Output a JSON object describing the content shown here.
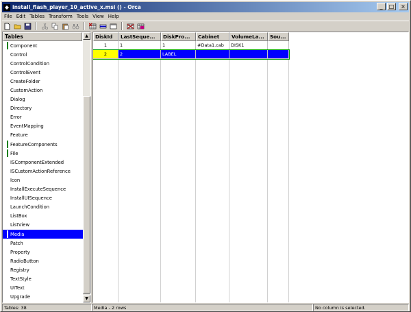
{
  "window": {
    "title": "install_flash_player_10_active_x.msi () - Orca"
  },
  "menu": [
    "File",
    "Edit",
    "Tables",
    "Transform",
    "Tools",
    "View",
    "Help"
  ],
  "left": {
    "header": "Tables",
    "items": [
      {
        "label": "Component",
        "marked": true,
        "selected": false
      },
      {
        "label": "Control",
        "marked": false,
        "selected": false
      },
      {
        "label": "ControlCondition",
        "marked": false,
        "selected": false
      },
      {
        "label": "ControlEvent",
        "marked": false,
        "selected": false
      },
      {
        "label": "CreateFolder",
        "marked": false,
        "selected": false
      },
      {
        "label": "CustomAction",
        "marked": false,
        "selected": false
      },
      {
        "label": "Dialog",
        "marked": false,
        "selected": false
      },
      {
        "label": "Directory",
        "marked": false,
        "selected": false
      },
      {
        "label": "Error",
        "marked": false,
        "selected": false
      },
      {
        "label": "EventMapping",
        "marked": false,
        "selected": false
      },
      {
        "label": "Feature",
        "marked": false,
        "selected": false
      },
      {
        "label": "FeatureComponents",
        "marked": true,
        "selected": false
      },
      {
        "label": "File",
        "marked": true,
        "selected": false
      },
      {
        "label": "ISComponentExtended",
        "marked": false,
        "selected": false
      },
      {
        "label": "ISCustomActionReference",
        "marked": false,
        "selected": false
      },
      {
        "label": "Icon",
        "marked": false,
        "selected": false
      },
      {
        "label": "InstallExecuteSequence",
        "marked": false,
        "selected": false
      },
      {
        "label": "InstallUISequence",
        "marked": false,
        "selected": false
      },
      {
        "label": "LaunchCondition",
        "marked": false,
        "selected": false
      },
      {
        "label": "ListBox",
        "marked": false,
        "selected": false
      },
      {
        "label": "ListView",
        "marked": false,
        "selected": false
      },
      {
        "label": "Media",
        "marked": true,
        "selected": true
      },
      {
        "label": "Patch",
        "marked": false,
        "selected": false
      },
      {
        "label": "Property",
        "marked": false,
        "selected": false
      },
      {
        "label": "RadioButton",
        "marked": false,
        "selected": false
      },
      {
        "label": "Registry",
        "marked": false,
        "selected": false
      },
      {
        "label": "TextStyle",
        "marked": false,
        "selected": false
      },
      {
        "label": "UIText",
        "marked": false,
        "selected": false
      },
      {
        "label": "Upgrade",
        "marked": false,
        "selected": false
      }
    ]
  },
  "grid": {
    "columns": [
      "DiskId",
      "LastSeque...",
      "DiskPro...",
      "Cabinet",
      "VolumeLa...",
      "Sou..."
    ],
    "rows": [
      [
        "1",
        "1",
        "1",
        "#Data1.cab",
        "DISK1",
        ""
      ],
      [
        "2",
        "2",
        "LABEL",
        "",
        "",
        ""
      ]
    ]
  },
  "status": {
    "tables": "Tables: 38",
    "rows": "Media - 2 rows",
    "column": "No column is selected."
  },
  "colors": {
    "title_start": "#0a246a",
    "title_end": "#a6caf0",
    "selection": "#0000ff",
    "focus_cell": "#ffff00",
    "mark": "#008000"
  }
}
